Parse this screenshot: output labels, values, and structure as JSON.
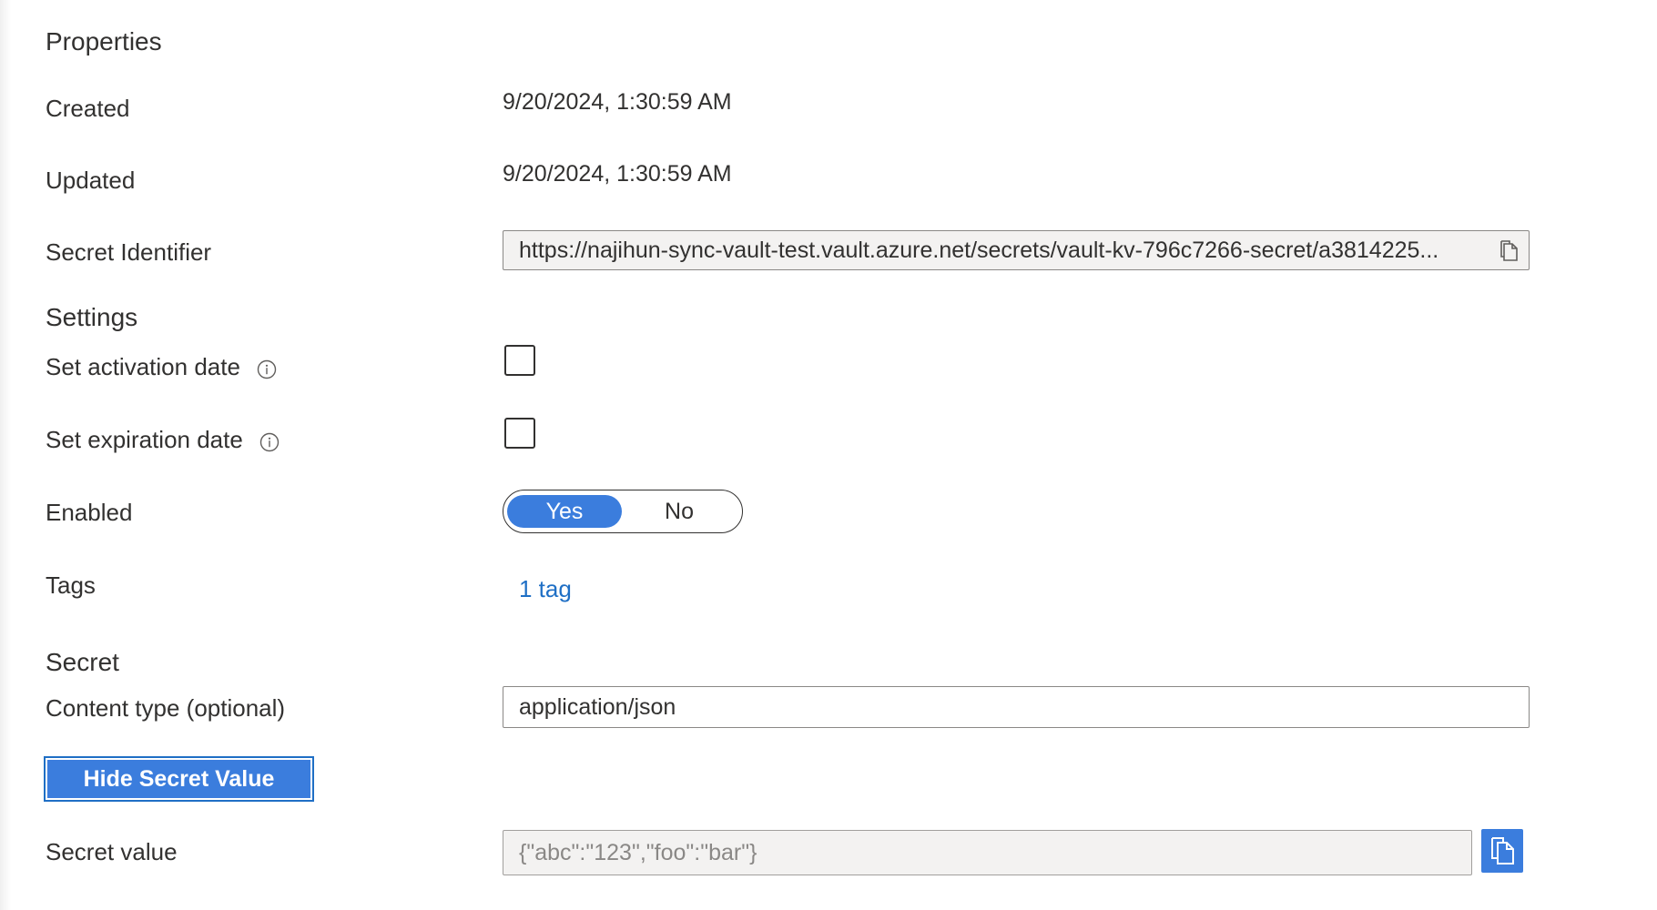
{
  "properties": {
    "heading": "Properties",
    "created_label": "Created",
    "created_value": "9/20/2024, 1:30:59 AM",
    "updated_label": "Updated",
    "updated_value": "9/20/2024, 1:30:59 AM",
    "secret_identifier_label": "Secret Identifier",
    "secret_identifier_value": "https://najihun-sync-vault-test.vault.azure.net/secrets/vault-kv-796c7266-secret/a3814225..."
  },
  "settings": {
    "heading": "Settings",
    "activation_label": "Set activation date",
    "activation_checked": false,
    "expiration_label": "Set expiration date",
    "expiration_checked": false,
    "enabled_label": "Enabled",
    "enabled_options": [
      "Yes",
      "No"
    ],
    "enabled_selected": "Yes",
    "tags_label": "Tags",
    "tags_link": "1 tag"
  },
  "secret": {
    "heading": "Secret",
    "content_type_label": "Content type (optional)",
    "content_type_value": "application/json",
    "hide_button_label": "Hide Secret Value",
    "secret_value_label": "Secret value",
    "secret_value": "{\"abc\":\"123\",\"foo\":\"bar\"}"
  },
  "colors": {
    "accent": "#3b7ddd",
    "link": "#1f6fc5",
    "readonly_bg": "#f3f2f1",
    "text": "#323130"
  },
  "icons": {
    "info": "info-icon",
    "copy": "copy-icon"
  }
}
